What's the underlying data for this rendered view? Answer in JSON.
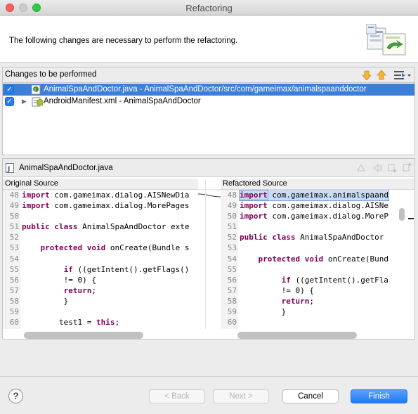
{
  "window": {
    "title": "Refactoring"
  },
  "header": {
    "message": "The following changes are necessary to perform the refactoring."
  },
  "changes": {
    "title": "Changes to be performed",
    "items": [
      {
        "label": "AnimalSpaAndDoctor.java - AnimalSpaAndDoctor/src/com/gameimax/animalspaanddoctor",
        "checked": true,
        "selected": true
      },
      {
        "label": "AndroidManifest.xml - AnimalSpaAndDoctor",
        "checked": true,
        "selected": false
      }
    ]
  },
  "compare": {
    "title": "AnimalSpaAndDoctor.java",
    "original": {
      "label": "Original Source",
      "line_numbers": [
        "48",
        "49",
        "50",
        "51",
        "52",
        "53",
        "54",
        "55",
        "56",
        "57",
        "58",
        "59",
        "60"
      ],
      "lines": [
        "import com.gameimax.dialog.AISNewDia",
        "import com.gameimax.dialog.MorePages",
        "",
        "public class AnimalSpaAndDoctor exte",
        "",
        "    protected void onCreate(Bundle s",
        "",
        "         if ((getIntent().getFlags()",
        "         != 0) {",
        "         return;",
        "         }",
        "",
        "        test1 = this;"
      ]
    },
    "refactored": {
      "label": "Refactored Source",
      "line_numbers": [
        "48",
        "49",
        "50",
        "51",
        "52",
        "53",
        "54",
        "55",
        "56",
        "57",
        "58",
        "59",
        "60"
      ],
      "lines": [
        "import com.gameimax.animalspaand",
        "import com.gameimax.dialog.AISNe",
        "import com.gameimax.dialog.MoreP",
        "",
        "public class AnimalSpaAndDoctor",
        "",
        "    protected void onCreate(Bund",
        "",
        "         if ((getIntent().getFla",
        "         != 0) {",
        "         return;",
        "         }",
        ""
      ]
    }
  },
  "buttons": {
    "help": "?",
    "back": "< Back",
    "next": "Next >",
    "cancel": "Cancel",
    "finish": "Finish"
  }
}
